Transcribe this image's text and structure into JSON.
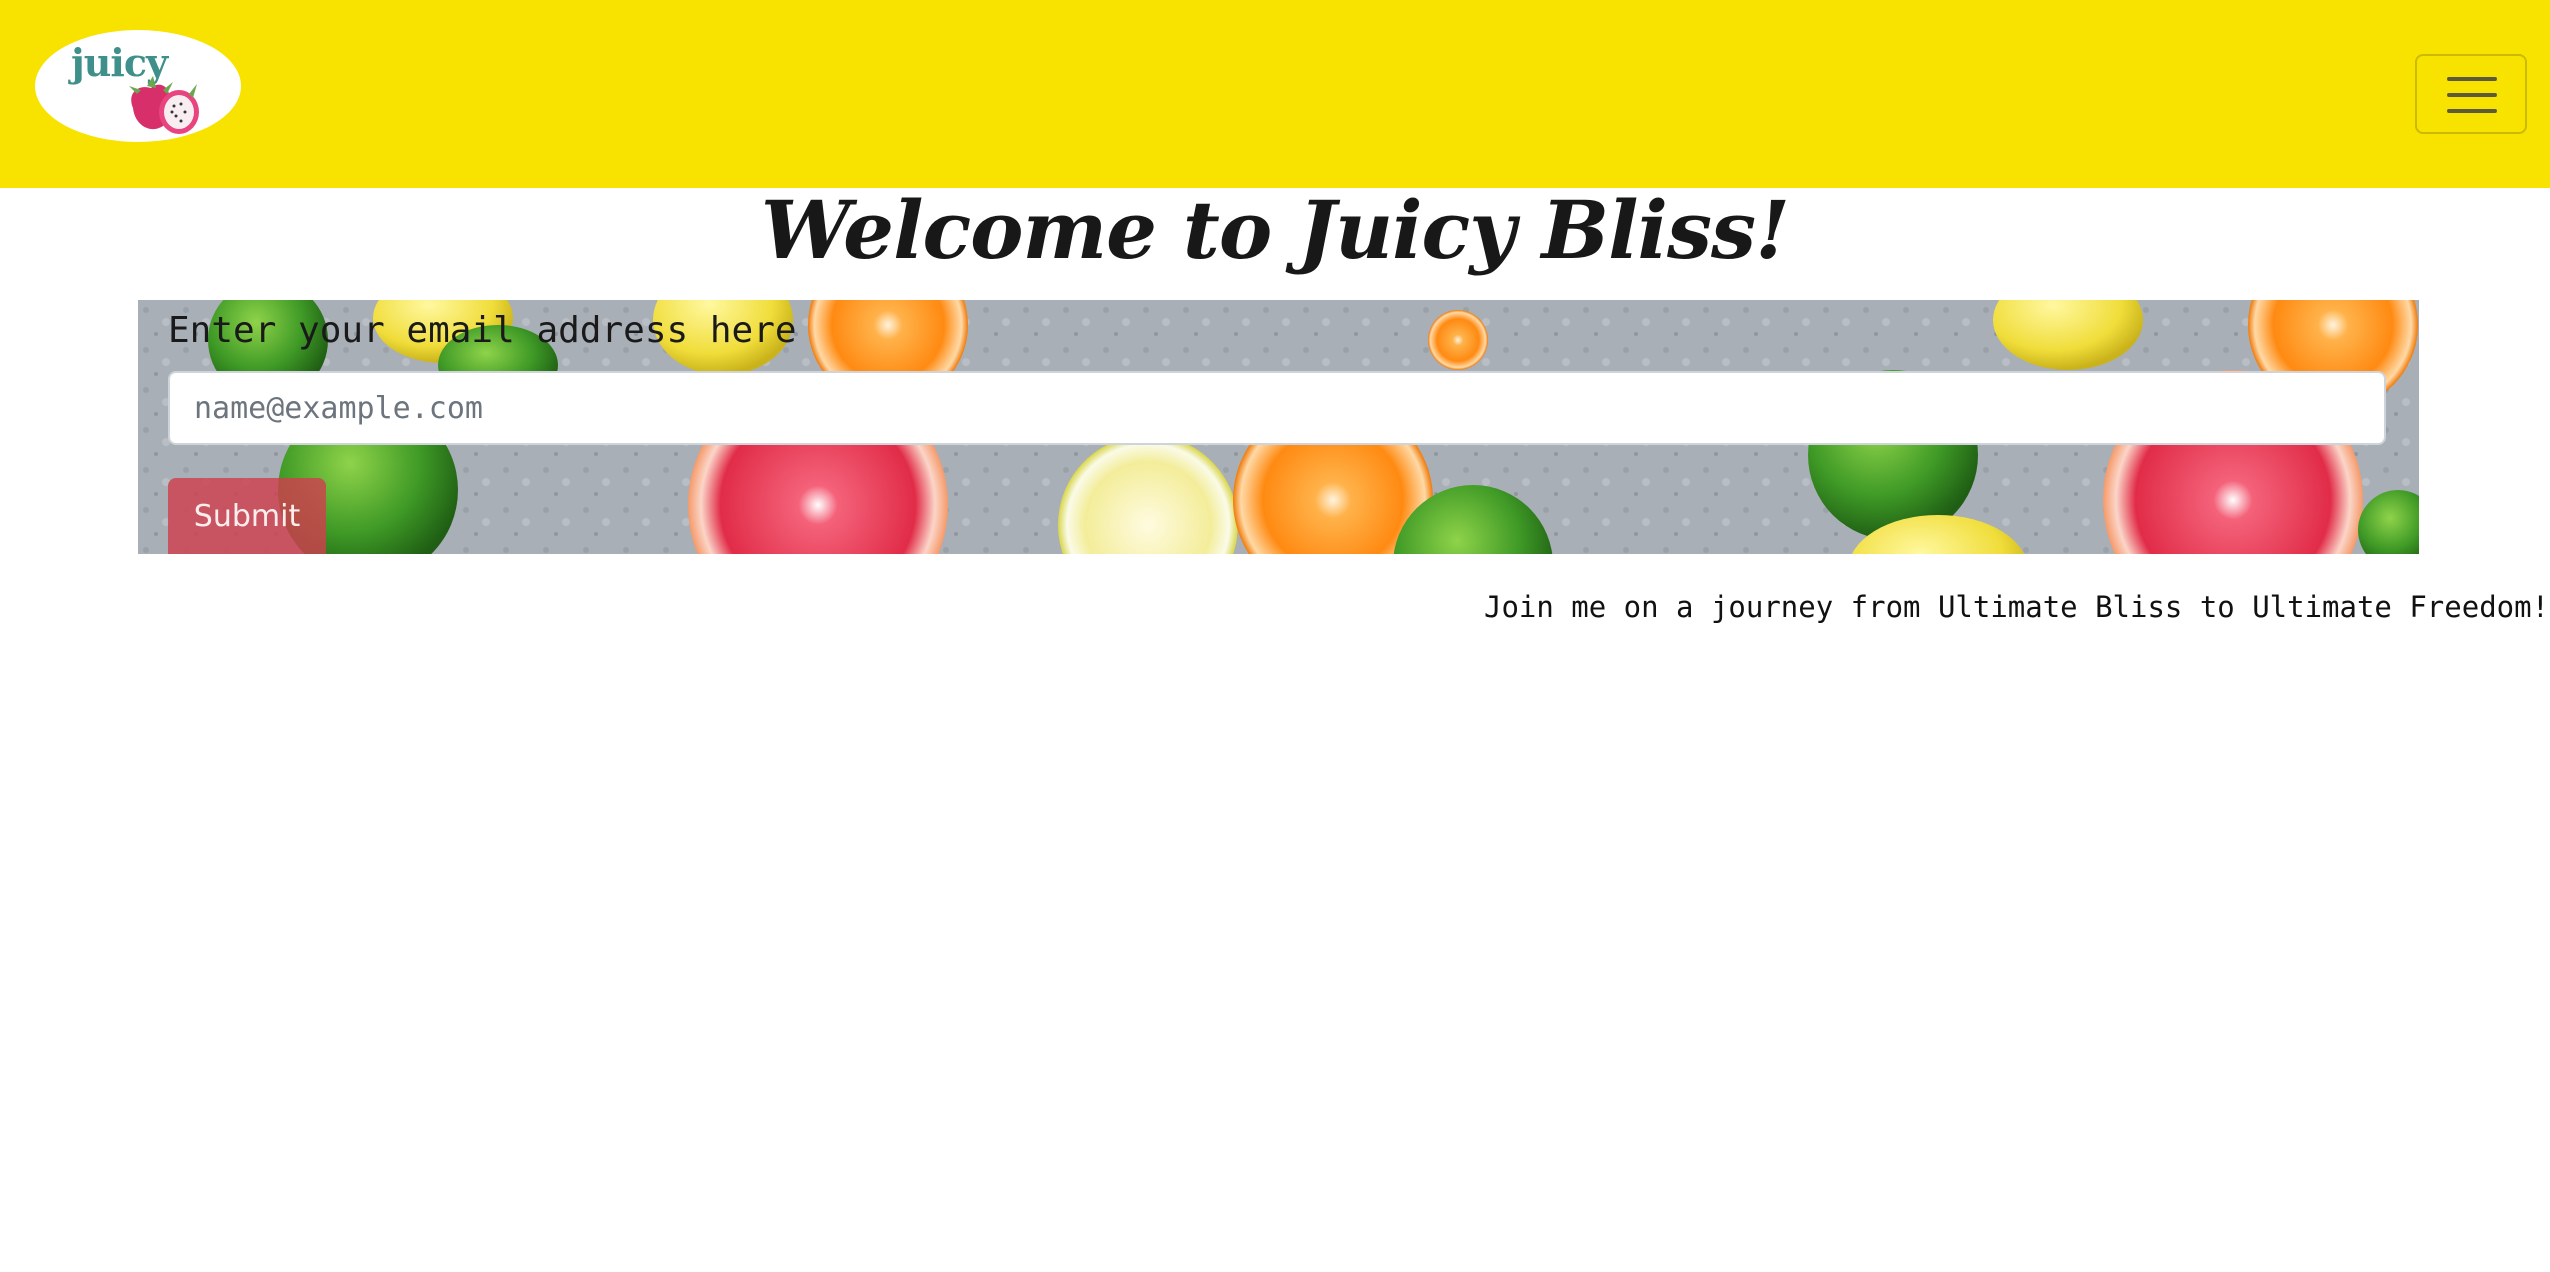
{
  "navbar": {
    "background": "#f8e300",
    "logo": {
      "text": "juicy",
      "icon": "dragon-fruit-icon"
    },
    "menu_toggle_icon": "hamburger-menu-icon"
  },
  "heading": "Welcome to Juicy Bliss!",
  "form": {
    "email_label": "Enter your email address here",
    "email_placeholder": "name@example.com",
    "email_value": "",
    "submit_label": "Submit",
    "submit_color": "#d0404e"
  },
  "tagline": "Join me on a journey from Ultimate Bliss to Ultimate Freedom!"
}
